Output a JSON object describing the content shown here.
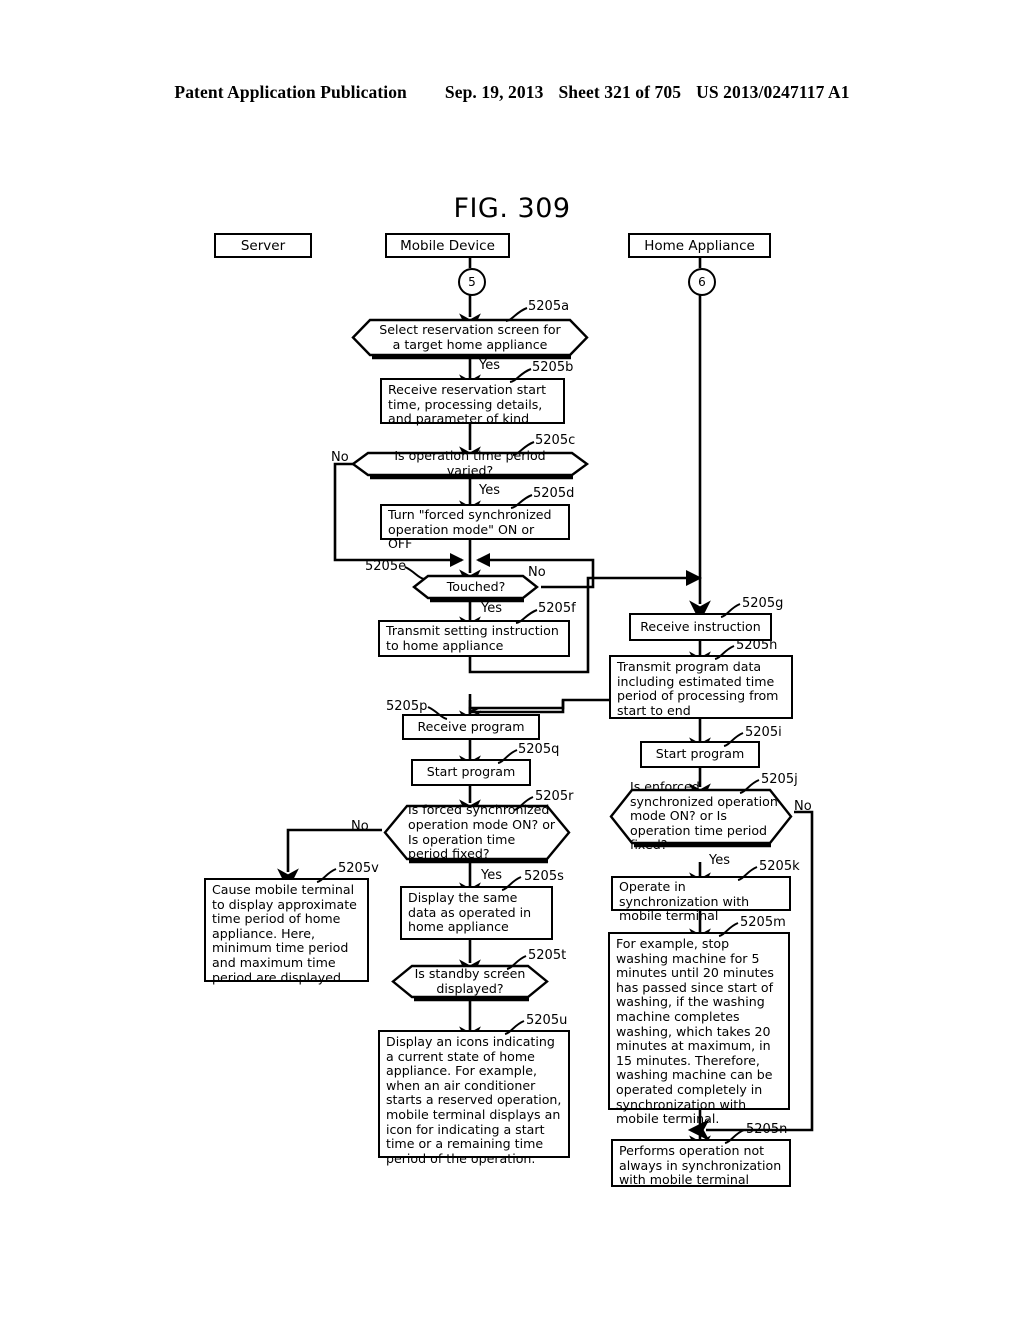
{
  "header": {
    "publication": "Patent Application Publication",
    "date": "Sep. 19, 2013",
    "sheet": "Sheet 321 of 705",
    "patent_number": "US 2013/0247117 A1"
  },
  "figure": {
    "title": "FIG. 309"
  },
  "lanes": [
    {
      "id": "server",
      "label": "Server"
    },
    {
      "id": "mobile-device",
      "label": "Mobile Device"
    },
    {
      "id": "home-appliance",
      "label": "Home Appliance"
    }
  ],
  "connectors": [
    {
      "id": "conn-5",
      "label": "5"
    },
    {
      "id": "conn-6",
      "label": "6"
    }
  ],
  "steps": {
    "s5205a": {
      "ref": "5205a",
      "text": "Select reservation screen for a target home appliance"
    },
    "s5205b": {
      "ref": "5205b",
      "text": "Receive reservation start time, processing details, and parameter of kind"
    },
    "s5205c": {
      "ref": "5205c",
      "text": "Is operation time period varied?"
    },
    "s5205d": {
      "ref": "5205d",
      "text": "Turn \"forced synchronized operation mode\" ON or OFF"
    },
    "s5205e": {
      "ref": "5205e",
      "text": "Touched?"
    },
    "s5205f": {
      "ref": "5205f",
      "text": "Transmit setting instruction to home appliance"
    },
    "s5205g": {
      "ref": "5205g",
      "text": "Receive instruction"
    },
    "s5205h": {
      "ref": "5205h",
      "text": "Transmit program data including estimated time period of processing from start to end"
    },
    "s5205i": {
      "ref": "5205i",
      "text": "Start program"
    },
    "s5205j": {
      "ref": "5205j",
      "text": "Is enforced synchronized operation mode ON? or Is operation time period fixed?"
    },
    "s5205k": {
      "ref": "5205k",
      "text": "Operate in synchronization with mobile terminal"
    },
    "s5205m": {
      "ref": "5205m",
      "text": "For example, stop washing machine for 5 minutes until 20 minutes has passed since start of washing, if the washing machine completes washing, which takes 20 minutes at maximum, in 15 minutes. Therefore, washing machine can be operated completely in synchronization with mobile terminal."
    },
    "s5205n": {
      "ref": "5205n",
      "text": "Performs operation not always in synchronization with mobile terminal"
    },
    "s5205p": {
      "ref": "5205p",
      "text": "Receive program"
    },
    "s5205q": {
      "ref": "5205q",
      "text": "Start program"
    },
    "s5205r": {
      "ref": "5205r",
      "text": "Is forced synchronized operation mode ON? or Is operation time period fixed?"
    },
    "s5205s": {
      "ref": "5205s",
      "text": "Display the same data as operated in home appliance"
    },
    "s5205t": {
      "ref": "5205t",
      "text": "Is standby screen displayed?"
    },
    "s5205u": {
      "ref": "5205u",
      "text": "Display an icons indicating a current state of home appliance.  For example, when an air conditioner starts a reserved operation, mobile terminal displays an icon for indicating a start time or a remaining time period of the operation."
    },
    "s5205v": {
      "ref": "5205v",
      "text": "Cause mobile terminal to display approximate time period of home appliance.  Here, minimum time period and maximum time period are displayed."
    }
  },
  "branch_labels": {
    "yes_a": "Yes",
    "no_c": "No",
    "yes_c": "Yes",
    "no_e": "No",
    "yes_e": "Yes",
    "no_j": "No",
    "yes_j": "Yes",
    "no_r": "No",
    "yes_r": "Yes"
  },
  "colors": {
    "ink": "#000000",
    "paper": "#ffffff"
  }
}
